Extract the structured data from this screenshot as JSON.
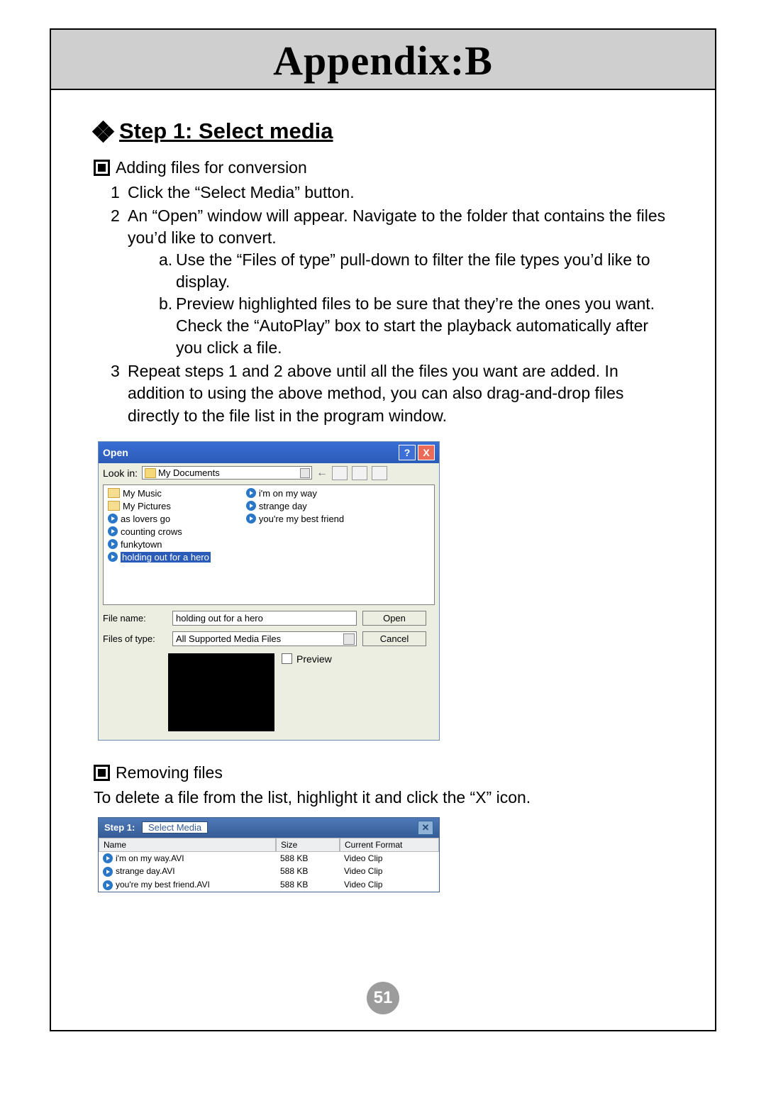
{
  "page": {
    "title": "Appendix:B",
    "number": "51"
  },
  "section": {
    "step_title": "Step 1: Select media",
    "adding_heading": "Adding files for conversion",
    "removing_heading": "Removing files",
    "removing_text": "To delete a file from the list, highlight it and click the “X” icon.",
    "steps": [
      "Click the “Select Media” button.",
      "An “Open” window will appear. Navigate to the folder that contains the files you’d like to convert.",
      "Repeat steps 1 and 2 above until all the files you want are added. In addition to using the above method, you can also drag-and-drop files directly to the file list in the program window."
    ],
    "sub_steps": [
      "Use the “Files of type” pull-down to filter the file types you’d like to display.",
      "Preview highlighted files to be sure that they’re the ones you want. Check the “AutoPlay” box to start the playback automatically after you click a file."
    ]
  },
  "open_dialog": {
    "title": "Open",
    "lookin_label": "Look in:",
    "lookin_value": "My Documents",
    "folders": [
      "My Music",
      "My Pictures"
    ],
    "files_col1": [
      "as lovers go",
      "counting crows",
      "funkytown",
      "holding out for a hero"
    ],
    "files_col2": [
      "i'm on my way",
      "strange day",
      "you're my best friend"
    ],
    "selected_file": "holding out for a hero",
    "filename_label": "File name:",
    "filename_value": "holding out for a hero",
    "filetype_label": "Files of type:",
    "filetype_value": "All Supported Media Files",
    "open_btn": "Open",
    "cancel_btn": "Cancel",
    "preview_label": "Preview"
  },
  "media_list": {
    "title_prefix": "Step 1:",
    "select_btn": "Select Media",
    "cols": [
      "Name",
      "Size",
      "Current Format"
    ],
    "rows": [
      {
        "name": "i'm on my way.AVI",
        "size": "588 KB",
        "format": "Video Clip"
      },
      {
        "name": "strange day.AVI",
        "size": "588 KB",
        "format": "Video Clip"
      },
      {
        "name": "you're my best friend.AVI",
        "size": "588 KB",
        "format": "Video Clip"
      }
    ]
  }
}
